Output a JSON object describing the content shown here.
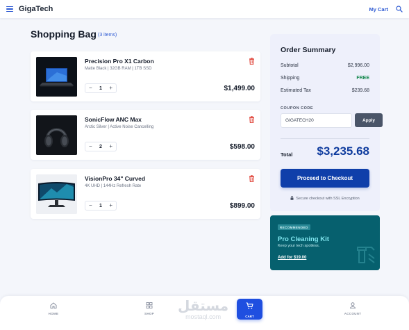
{
  "header": {
    "brand": "GigaTech",
    "my_cart": "My Cart"
  },
  "page": {
    "title": "Shopping Bag",
    "items_count": "(3 items)"
  },
  "cart_items": [
    {
      "name": "Precision Pro X1 Carbon",
      "spec": "Matte Black | 32GB RAM | 1TB SSD",
      "qty": "1",
      "price": "$1,499.00"
    },
    {
      "name": "SonicFlow ANC Max",
      "spec": "Arctic Silver | Active Noise Cancelling",
      "qty": "2",
      "price": "$598.00"
    },
    {
      "name": "VisionPro 34\" Curved",
      "spec": "4K UHD | 144Hz Refresh Rate",
      "qty": "1",
      "price": "$899.00"
    }
  ],
  "summary": {
    "title": "Order Summary",
    "subtotal_label": "Subtotal",
    "subtotal_value": "$2,996.00",
    "shipping_label": "Shipping",
    "shipping_value": "FREE",
    "tax_label": "Estimated Tax",
    "tax_value": "$239.68",
    "coupon_label": "COUPON CODE",
    "coupon_value": "GIGATECH20",
    "apply_label": "Apply",
    "total_label": "Total",
    "total_value": "$3,235.68",
    "checkout_label": "Proceed to Checkout",
    "secure_note": "Secure checkout with SSL Encryption"
  },
  "promo": {
    "badge": "RECOMMENDED",
    "title": "Pro Cleaning Kit",
    "subtitle": "Keep your tech spotless.",
    "link": "Add for $19.00"
  },
  "bottom_nav": {
    "home": "HOME",
    "shop": "SHOP",
    "cart": "CART",
    "account": "ACCOUNT"
  },
  "watermark": {
    "arabic": "مستقل",
    "latin": "mostaql.com"
  },
  "colors": {
    "accent": "#2f5bd3",
    "checkout": "#0f3faa",
    "total": "#0e3b9e",
    "promo_bg": "#06606e",
    "trash": "#e0453a"
  }
}
